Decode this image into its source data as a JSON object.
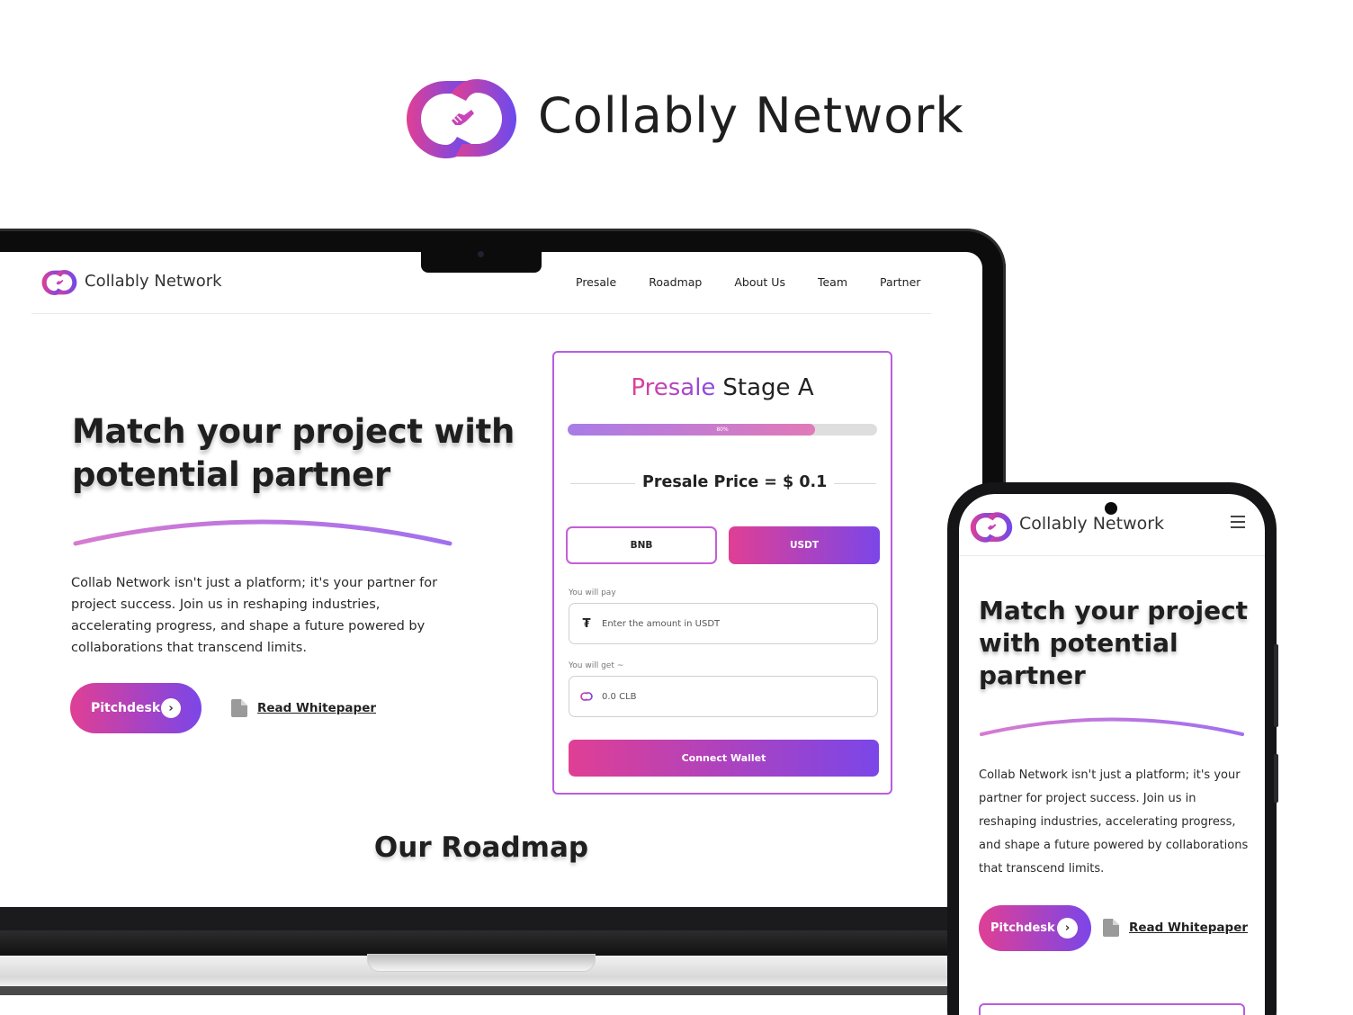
{
  "brand": {
    "name": "Collably Network"
  },
  "nav": {
    "logo_text": "Collably Network",
    "links": [
      "Presale",
      "Roadmap",
      "About Us",
      "Team",
      "Partner"
    ]
  },
  "hero": {
    "title": "Match your project with potential partner",
    "description": "Collab Network isn't just a platform; it's your partner for project success. Join us in reshaping industries, accelerating progress, and shape a future powered by collaborations that transcend limits.",
    "pitch_label": "Pitchdesk",
    "whitepaper_label": "Read Whitepaper"
  },
  "presale": {
    "title_highlight": "Presale",
    "title_rest": "Stage A",
    "progress_label": "80%",
    "progress_fraction": 0.8,
    "price_text": "Presale Price = $ 0.1",
    "token_bnb": "BNB",
    "token_usdt": "USDT",
    "pay_label": "You will pay",
    "pay_placeholder": "Enter the amount in USDT",
    "get_label": "You will get ~",
    "get_value": "0.0 CLB",
    "connect_label": "Connect Wallet"
  },
  "roadmap": {
    "title": "Our Roadmap"
  },
  "mobile": {
    "logo_text": "Collably Network",
    "title": "Match your project with potential partner",
    "description": "Collab Network isn't just a platform; it's your partner for project success. Join us in reshaping industries, accelerating progress, and shape a future powered by collaborations that transcend limits.",
    "pitch_label": "Pitchdesk",
    "whitepaper_label": "Read Whitepaper"
  },
  "colors": {
    "accent_pink": "#e03f94",
    "accent_purple": "#7b46e8",
    "card_border": "#b85de0"
  }
}
